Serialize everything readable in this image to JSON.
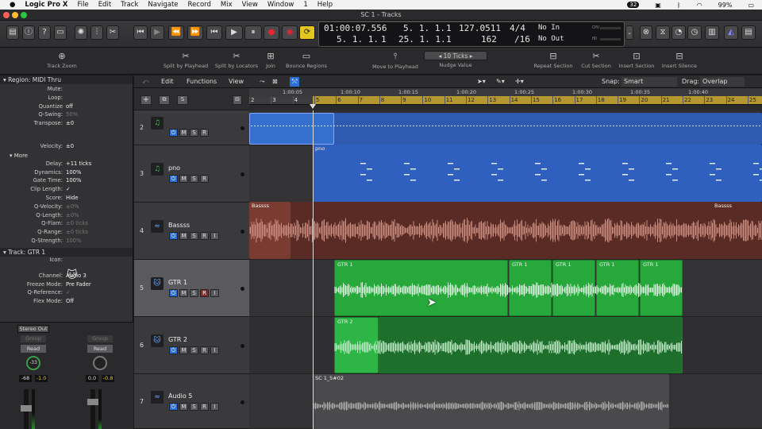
{
  "menubar": {
    "apple": "",
    "app": "Logic Pro X",
    "items": [
      "File",
      "Edit",
      "Track",
      "Navigate",
      "Record",
      "Mix",
      "View",
      "Window",
      "1",
      "Help"
    ],
    "right": {
      "badge": "32",
      "battery": "99%"
    }
  },
  "window": {
    "title": "SC 1 - Tracks"
  },
  "lcd": {
    "time": "01:00:07.556",
    "bars_top": "5. 1. 1.",
    "bars_top_n": "1",
    "tempo": "127.0511",
    "sig_top": "4/4",
    "in": "No In",
    "bars_bot": "5. 1. 1.",
    "bars_bot_n": "1",
    "bars_bot2": "25. 1. 1.",
    "bars_bot2_n": "1",
    "tempo2": "162",
    "sig_bot": "/16",
    "out": "No Out",
    "cpu": "CPU",
    "hd": "HD"
  },
  "toolbar": {
    "track_zoom": "Track Zoom",
    "split_playhead": "Split by Playhead",
    "split_locators": "Split by Locators",
    "join": "Join",
    "bounce_regions": "Bounce Regions",
    "move_playhead": "Move to Playhead",
    "nudge_value": "Nudge Value",
    "nudge_amount": "10 Ticks",
    "repeat_section": "Repeat Section",
    "cut_section": "Cut Section",
    "insert_section": "Insert Section",
    "insert_silence": "Insert Silence"
  },
  "inspector": {
    "region_header": "Region:",
    "region_name": "MIDI Thru",
    "rows": [
      {
        "l": "Mute:",
        "v": ""
      },
      {
        "l": "Loop:",
        "v": ""
      },
      {
        "l": "Quantize",
        "v": "off"
      },
      {
        "l": "Q-Swing:",
        "v": "50%"
      },
      {
        "l": "Transpose:",
        "v": "±0"
      },
      {
        "l": "Velocity:",
        "v": "±0"
      }
    ],
    "more": "More",
    "more_rows": [
      {
        "l": "Delay:",
        "v": "+11 ticks"
      },
      {
        "l": "Dynamics:",
        "v": "100%"
      },
      {
        "l": "Gate Time:",
        "v": "100%"
      },
      {
        "l": "Clip Length:",
        "v": "✓"
      },
      {
        "l": "Score:",
        "v": "Hide"
      },
      {
        "l": "Q-Velocity:",
        "v": "±0%"
      },
      {
        "l": "Q-Length:",
        "v": "±0%"
      },
      {
        "l": "Q-Flam:",
        "v": "±0 ticks"
      },
      {
        "l": "Q-Range:",
        "v": "±0 ticks"
      },
      {
        "l": "Q-Strength:",
        "v": "100%"
      }
    ],
    "track_header": "Track:",
    "track_name": "GTR 1",
    "track_rows": [
      {
        "l": "Icon:",
        "v": ""
      },
      {
        "l": "Channel:",
        "v": "Audio 3"
      },
      {
        "l": "Freeze Mode:",
        "v": "Pre Fader"
      },
      {
        "l": "Q-Reference:",
        "v": "✓"
      },
      {
        "l": "Flex Mode:",
        "v": "Off"
      }
    ],
    "strip": {
      "stereo_out": "Stereo Out",
      "group": "Group",
      "read": "Read",
      "pan_val": "-33",
      "vol1": "-68",
      "vol2": "-1.0",
      "vol3": "0.0",
      "vol4": "-0.8"
    }
  },
  "trackhdr": {
    "edit": "Edit",
    "functions": "Functions",
    "view": "View",
    "snap_label": "Snap:",
    "snap_val": "Smart",
    "drag_label": "Drag:",
    "drag_val": "Overlap",
    "s": "S"
  },
  "ruler": {
    "bars": [
      "2",
      "3",
      "4",
      "5",
      "6",
      "7",
      "8",
      "9",
      "10",
      "11",
      "12",
      "13",
      "14",
      "15",
      "16",
      "17",
      "18",
      "19",
      "20",
      "21",
      "22",
      "23",
      "24",
      "25"
    ],
    "times": [
      "1:00:05",
      "1:00:10",
      "1:00:15",
      "1:00:20",
      "1:00:25",
      "1:00:30",
      "1:00:35",
      "1:00:40"
    ]
  },
  "tracks": [
    {
      "num": "2",
      "name": "",
      "icon": "♫"
    },
    {
      "num": "3",
      "name": "pno",
      "icon": "♫"
    },
    {
      "num": "4",
      "name": "Bassss",
      "icon": "≈"
    },
    {
      "num": "5",
      "name": "GTR 1",
      "icon": "🐱"
    },
    {
      "num": "6",
      "name": "GTR 2",
      "icon": "🐱"
    },
    {
      "num": "7",
      "name": "Audio 5",
      "icon": "≈"
    }
  ],
  "regions": {
    "pno": "pno",
    "bass1": "Bassss",
    "bass2": "Bassss",
    "gtr1": "GTR 1",
    "gtr2": "GTR 2",
    "audio5": "SC 1_5#02"
  },
  "colors": {
    "midi_blue": "#2f5fbf",
    "bass_brown": "#5a2b24",
    "green": "#27a83b",
    "grey_region": "#4a4a4c"
  }
}
